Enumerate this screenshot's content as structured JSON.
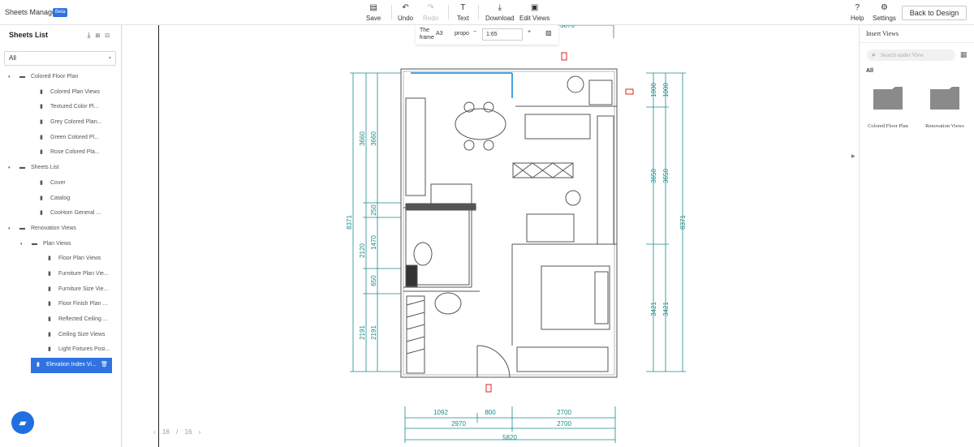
{
  "app": {
    "title": "Sheets Manager",
    "badge": "Beta"
  },
  "toolbar": {
    "save": "Save",
    "undo": "Undo",
    "redo": "Redo",
    "text": "Text",
    "download": "Download",
    "edit_views": "Edit Views",
    "help": "Help",
    "settings": "Settings",
    "back": "Back to Design"
  },
  "left_panel": {
    "title": "Sheets List",
    "filter_value": "All",
    "items": [
      {
        "label": "Colored Floor Plan",
        "level": 0,
        "type": "folder",
        "expanded": true,
        "selected": false
      },
      {
        "label": "Colored Plan Views",
        "level": 1,
        "type": "sheet",
        "selected": false
      },
      {
        "label": "Textured Color Pl...",
        "level": 1,
        "type": "sheet",
        "selected": false
      },
      {
        "label": "Grey Colored Plan...",
        "level": 1,
        "type": "sheet",
        "selected": false
      },
      {
        "label": "Green Colored Pl...",
        "level": 1,
        "type": "sheet",
        "selected": false
      },
      {
        "label": "Rose Colored Pla...",
        "level": 1,
        "type": "sheet",
        "selected": false
      },
      {
        "label": "Sheets List",
        "level": 0,
        "type": "folder",
        "expanded": true,
        "selected": false
      },
      {
        "label": "Cover",
        "level": 1,
        "type": "sheet",
        "selected": false
      },
      {
        "label": "Catalog",
        "level": 1,
        "type": "sheet",
        "selected": false
      },
      {
        "label": "CooHom General ...",
        "level": 1,
        "type": "sheet",
        "selected": false
      },
      {
        "label": "Renovation Views",
        "level": 0,
        "type": "folder",
        "expanded": true,
        "selected": false
      },
      {
        "label": "Plan Views",
        "level": 1,
        "type": "folder",
        "expanded": true,
        "selected": false
      },
      {
        "label": "Floor Plan Views",
        "level": 2,
        "type": "sheet",
        "selected": false
      },
      {
        "label": "Furniture Plan Vie...",
        "level": 2,
        "type": "sheet",
        "selected": false
      },
      {
        "label": "Furniture Size Vie...",
        "level": 2,
        "type": "sheet",
        "selected": false
      },
      {
        "label": "Floor Finish Plan ...",
        "level": 2,
        "type": "sheet",
        "selected": false
      },
      {
        "label": "Reflected Ceiling ...",
        "level": 2,
        "type": "sheet",
        "selected": false
      },
      {
        "label": "Ceiling Size Views",
        "level": 2,
        "type": "sheet",
        "selected": false
      },
      {
        "label": "Light Fixtures Posi...",
        "level": 2,
        "type": "sheet",
        "selected": false
      },
      {
        "label": "Elevation Index Vi...",
        "level": 2,
        "type": "sheet",
        "selected": true
      }
    ]
  },
  "canvas": {
    "frame_label": "The frame",
    "paper_size": "A3",
    "proportion_label": "propo",
    "scale": "1:65",
    "pager": {
      "prev": "‹",
      "current": "16",
      "sep": "/",
      "total": "16",
      "next": "›"
    },
    "dims": {
      "top_partial": "3070",
      "left_outer": "8371",
      "left_mid": [
        "3660",
        "2120",
        "2191"
      ],
      "left_inner": [
        "3660",
        "250",
        "1470",
        "650",
        "2191"
      ],
      "right_inner": [
        "1000",
        "3650",
        "3421"
      ],
      "right_outer_a": [
        "1000",
        "3650",
        "3421"
      ],
      "right_total": "8371",
      "bottom_row1": [
        "1092",
        "800",
        "2700"
      ],
      "bottom_row2": [
        "2970",
        "2700"
      ],
      "bottom_total": "5820"
    }
  },
  "right_panel": {
    "title": "Insert Views",
    "search_placeholder": "Search under View",
    "category": "All",
    "views": [
      "Colored Floor Plan",
      "Renovation Views"
    ]
  },
  "colors": {
    "accent": "#2f73e0",
    "dimension": "#1a8a8a",
    "marker": "#e02020",
    "wall": "#555555"
  },
  "icons": {
    "save": "save-icon",
    "undo": "undo-icon",
    "redo": "redo-icon",
    "text": "text-icon",
    "download": "download-icon",
    "edit_views": "edit-views-icon",
    "help": "help-icon",
    "settings": "settings-icon",
    "search": "search-icon",
    "chat": "chat-icon"
  }
}
